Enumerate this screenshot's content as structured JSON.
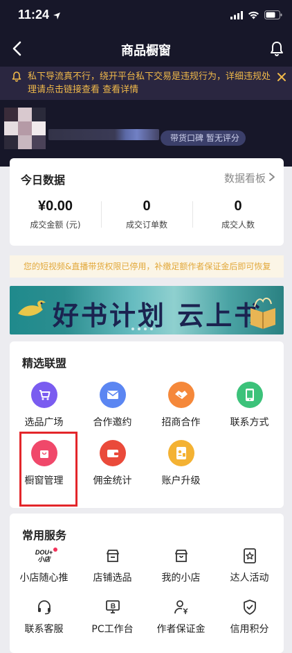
{
  "status_bar": {
    "time": "11:24"
  },
  "nav": {
    "title": "商品橱窗"
  },
  "notice": {
    "text": "私下导流真不行，绕开平台私下交易是违规行为，详细违规处理请点击链接查看 查看详情"
  },
  "profile": {
    "badge": "带货口碑 暂无评分"
  },
  "today_data": {
    "title": "今日数据",
    "link_label": "数据看板",
    "stats": [
      {
        "value": "¥0.00",
        "label": "成交金额 (元)"
      },
      {
        "value": "0",
        "label": "成交订单数"
      },
      {
        "value": "0",
        "label": "成交人数"
      }
    ]
  },
  "warning": {
    "text": "您的短视频&直播带货权限已停用，补缴足额作者保证金后即可恢复"
  },
  "banner": {
    "text": "好书计划 云上书香"
  },
  "alliance": {
    "title": "精选联盟",
    "items": [
      {
        "label": "选品广场",
        "icon": "cart-icon",
        "color": "#7a5cf0"
      },
      {
        "label": "合作邀约",
        "icon": "envelope-icon",
        "color": "#5b86f2"
      },
      {
        "label": "招商合作",
        "icon": "handshake-icon",
        "color": "#f5883a"
      },
      {
        "label": "联系方式",
        "icon": "phone-icon",
        "color": "#3cc27a"
      },
      {
        "label": "橱窗管理",
        "icon": "bag-icon",
        "color": "#f0486a"
      },
      {
        "label": "佣金统计",
        "icon": "wallet-icon",
        "color": "#ea4a3a"
      },
      {
        "label": "账户升级",
        "icon": "account-card-icon",
        "color": "#f4b233"
      }
    ]
  },
  "services": {
    "title": "常用服务",
    "logo_text_top": "DOU+",
    "logo_text_bottom": "小店",
    "items": [
      {
        "label": "小店随心推",
        "icon": "dou-plus-icon"
      },
      {
        "label": "店铺选品",
        "icon": "store-icon"
      },
      {
        "label": "我的小店",
        "icon": "shop-icon"
      },
      {
        "label": "达人活动",
        "icon": "star-badge-icon"
      },
      {
        "label": "联系客服",
        "icon": "headset-icon"
      },
      {
        "label": "PC工作台",
        "icon": "monitor-icon"
      },
      {
        "label": "作者保证金",
        "icon": "user-yuan-icon"
      },
      {
        "label": "信用积分",
        "icon": "shield-check-icon"
      }
    ]
  }
}
